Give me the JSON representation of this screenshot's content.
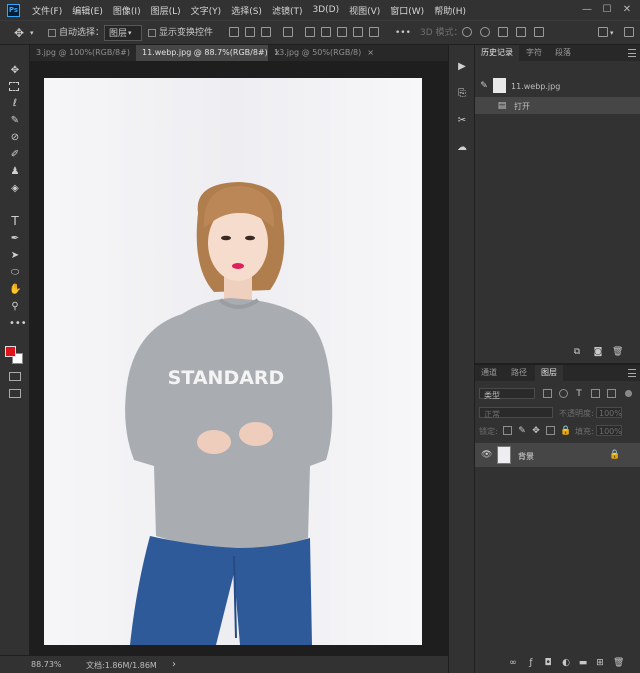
{
  "app": {
    "logo": "Ps"
  },
  "menu": [
    "文件(F)",
    "编辑(E)",
    "图像(I)",
    "图层(L)",
    "文字(Y)",
    "选择(S)",
    "滤镜(T)",
    "3D(D)",
    "视图(V)",
    "窗口(W)",
    "帮助(H)"
  ],
  "window_controls": {
    "minimize": "—",
    "maximize": "☐",
    "close": "✕"
  },
  "options": {
    "auto_select_label": "自动选择：",
    "auto_select_value": "图层",
    "show_transform_label": "显示变换控件",
    "more_label": "•••",
    "mode_3d_label": "3D 模式："
  },
  "tabs": [
    {
      "label": "3.jpg @ 100%(RGB/8#)",
      "close": "×",
      "active": false
    },
    {
      "label": "11.webp.jpg @ 88.7%(RGB/8#)",
      "close": "×",
      "active": true
    },
    {
      "label": "13.jpg @ 50%(RGB/8)",
      "close": "×",
      "active": false
    }
  ],
  "canvas": {
    "shirt_text": "STANDARD",
    "colors": {
      "background": "#f3f3f5",
      "sweater": "#a9adb1",
      "jeans": "#2f5a9a",
      "hair": "#b78352",
      "lips": "#e0205a"
    }
  },
  "status": {
    "zoom": "88.73%",
    "doc_info": "文档:1.86M/1.86M",
    "arrow": "›"
  },
  "foreground_color": "#e0121b",
  "background_color": "#ffffff",
  "history_panel": {
    "tabs": [
      "历史记录",
      "字符",
      "段落"
    ],
    "snapshot_name": "11.webp.jpg",
    "steps": [
      "打开"
    ]
  },
  "layers_panel": {
    "tabs": [
      "通道",
      "路径",
      "图层"
    ],
    "filter_type": "类型",
    "blend_mode": "正常",
    "opacity_label": "不透明度:",
    "opacity_value": "100%",
    "lock_label": "锁定:",
    "fill_label": "填充:",
    "fill_value": "100%",
    "layers": [
      {
        "name": "背景",
        "visible": true,
        "locked": true
      }
    ]
  },
  "icons": [
    "move-icon",
    "marquee-icon",
    "lasso-icon",
    "quick-select-icon",
    "eyedropper-icon",
    "brush-icon",
    "stamp-icon",
    "eraser-icon",
    "type-icon",
    "pen-icon",
    "path-select-icon",
    "ellipse-icon",
    "hand-icon",
    "zoom-icon",
    "more-tools-icon",
    "quick-mask-icon",
    "screen-mode-icon",
    "play-icon",
    "history-icon",
    "tools-icon",
    "cc-libraries-icon",
    "eye-icon",
    "lock-icon",
    "trash-icon"
  ]
}
